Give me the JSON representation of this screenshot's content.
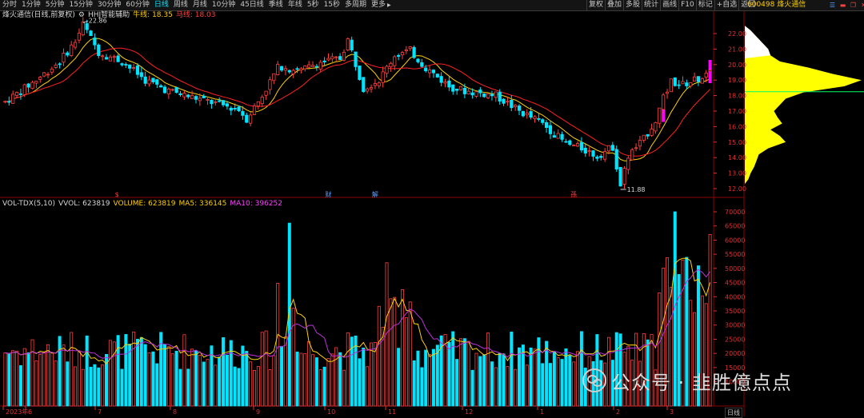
{
  "toolbar": {
    "period_tabs": [
      "分时",
      "1分钟",
      "5分钟",
      "15分钟",
      "30分钟",
      "60分钟",
      "日线",
      "周线",
      "月线",
      "10分钟",
      "45日线",
      "季线",
      "年线",
      "5秒",
      "15秒",
      "多周期",
      "更多"
    ],
    "active_tab": "日线",
    "tools": [
      "复权",
      "叠加",
      "多股",
      "统计",
      "画线",
      "F10",
      "标记",
      "+自选",
      "返回"
    ],
    "stock_code": "600498 烽火通信",
    "window_icons": [
      "menu-icon",
      "minimize-icon",
      "restore-icon",
      "close-icon"
    ]
  },
  "price_panel": {
    "name": "烽火通信(日线,前复权)",
    "indicator": "HHJ智能辅助",
    "bull_label": "牛线: 18.35",
    "bear_label": "马线: 18.03",
    "high_label": "22.86",
    "low_label": "11.88",
    "event_markers": [
      {
        "text": "$",
        "color": "#ff4040",
        "index": 29
      },
      {
        "text": "财",
        "color": "#5aa0ff",
        "index": 83
      },
      {
        "text": "解",
        "color": "#5aa0ff",
        "index": 95
      },
      {
        "text": "孫",
        "color": "#ff4040",
        "index": 146
      }
    ],
    "scale": [
      "22.00",
      "21.00",
      "20.00",
      "19.00",
      "18.00",
      "17.00",
      "16.00",
      "15.00",
      "14.00",
      "13.00",
      "12.00"
    ]
  },
  "volume_panel": {
    "name": "VOL-TDX(5,10)",
    "vvol": "VVOL: 623819",
    "volume": "VOLUME: 623819",
    "ma5": "MA5: 336145",
    "ma10": "MA10: 396252",
    "scale": [
      "70000",
      "65000",
      "60000",
      "55000",
      "50000",
      "45000",
      "40000",
      "35000",
      "30000",
      "25000",
      "20000",
      "15000",
      "10000"
    ]
  },
  "colors": {
    "up": "#ff4040",
    "down": "#00e5ff",
    "ma_fast": "#ffd000",
    "ma_slow": "#ff2020",
    "vol_ma5": "#ffd000",
    "vol_ma10": "#c030e0",
    "profile": "#ffff00",
    "highlight": "#ff00ff"
  },
  "date_axis": [
    "2023年",
    "6",
    "7",
    "8",
    "9",
    "10",
    "11",
    "12",
    "1",
    "2",
    "3"
  ],
  "period_label": "日线",
  "watermark": "公众号 · 韭胜億点点"
}
